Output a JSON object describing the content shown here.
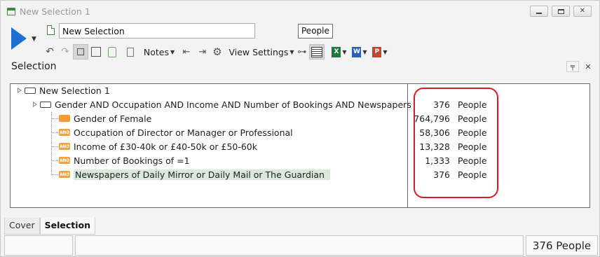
{
  "window": {
    "title": "New Selection 1"
  },
  "toolbar": {
    "selection_name": "New Selection",
    "count_unit_label": "People",
    "notes_label": "Notes",
    "view_settings_label": "View Settings"
  },
  "panel": {
    "title": "Selection"
  },
  "tree": {
    "root": "New Selection 1",
    "group": "Gender AND Occupation AND Income AND Number of Bookings AND Newspapers",
    "items": [
      {
        "label": "Gender of Female",
        "tag": "female"
      },
      {
        "label": "Occupation of Director or Manager or Professional",
        "tag": "AND"
      },
      {
        "label": "Income of £30-40k or £40-50k or £50-60k",
        "tag": "AND"
      },
      {
        "label": "Number of Bookings of =1",
        "tag": "AND"
      },
      {
        "label": "Newspapers of Daily Mirror or Daily Mail or The Guardian",
        "tag": "AND"
      }
    ]
  },
  "counts": [
    {
      "value": "376",
      "unit": "People"
    },
    {
      "value": "764,796",
      "unit": "People"
    },
    {
      "value": "58,306",
      "unit": "People"
    },
    {
      "value": "13,328",
      "unit": "People"
    },
    {
      "value": "1,333",
      "unit": "People"
    },
    {
      "value": "376",
      "unit": "People"
    }
  ],
  "tabs": [
    "Cover",
    "Selection"
  ],
  "status": {
    "total": "376 People"
  },
  "colors": {
    "accent_blue": "#1f6fd1",
    "highlight_red": "#d81b24",
    "tag_orange": "#f39c32"
  }
}
